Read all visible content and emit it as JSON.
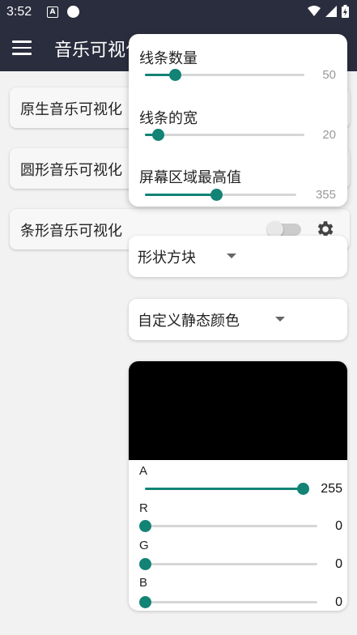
{
  "status": {
    "time": "3:52",
    "a_icon": "A"
  },
  "app": {
    "title": "音乐可视化"
  },
  "background_cards": [
    {
      "label": "原生音乐可视化"
    },
    {
      "label": "圆形音乐可视化"
    },
    {
      "label": "条形音乐可视化",
      "switch_on": false
    }
  ],
  "popup": {
    "sliders": [
      {
        "label": "线条数量",
        "value": "50",
        "fraction": 0.19
      },
      {
        "label": "线条的宽",
        "value": "20",
        "fraction": 0.08
      },
      {
        "label": "屏幕区域最高值",
        "value": "355",
        "fraction": 0.47
      }
    ]
  },
  "shape_dropdown": {
    "selected": "形状方块"
  },
  "color_dropdown": {
    "selected": "自定义静态颜色"
  },
  "color_picker": {
    "preview_color": "#000000",
    "accent_color": "#128375",
    "channels": [
      {
        "label": "A",
        "value": "255",
        "fraction": 1.0
      },
      {
        "label": "R",
        "value": "0",
        "fraction": 0.0
      },
      {
        "label": "G",
        "value": "0",
        "fraction": 0.0
      },
      {
        "label": "B",
        "value": "0",
        "fraction": 0.0
      }
    ]
  }
}
